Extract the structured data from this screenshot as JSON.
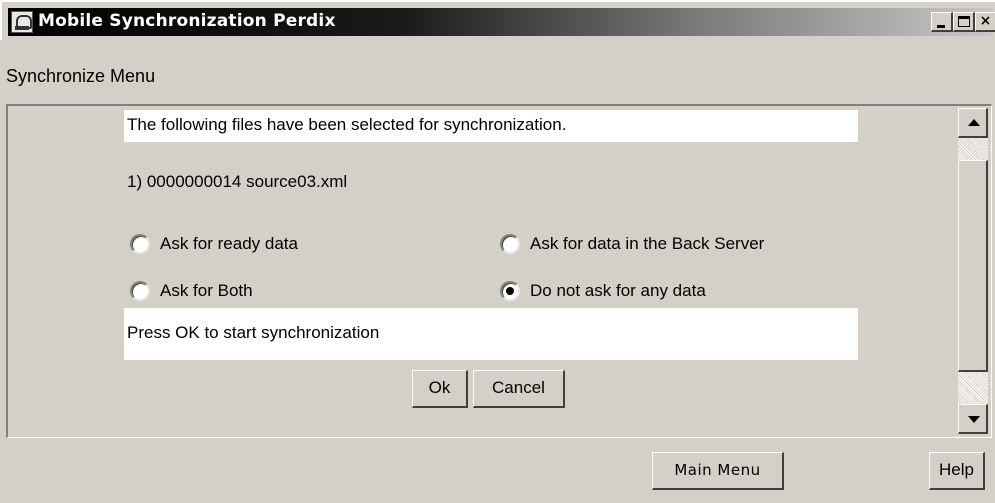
{
  "window": {
    "title": "Mobile Synchronization Perdix",
    "icon": "perdix-app-icon",
    "controls": {
      "minimize": "minimize-icon",
      "maximize": "maximize-icon",
      "close": "×"
    }
  },
  "menu_label": "Synchronize Menu",
  "sync": {
    "header": "The following files have been selected for synchronization.",
    "files": [
      {
        "line": "1) 0000000014   source03.xml"
      }
    ],
    "options": [
      {
        "label": "Ask for ready data",
        "checked": false
      },
      {
        "label": "Ask for data in the Back Server",
        "checked": false
      },
      {
        "label": "Ask for Both",
        "checked": false
      },
      {
        "label": "Do not ask for any data",
        "checked": true
      }
    ],
    "prompt": "Press OK to start synchronization",
    "ok_label": "Ok",
    "cancel_label": "Cancel"
  },
  "scrollbar": {
    "up_icon": "arrow-up-icon",
    "down_icon": "arrow-down-icon"
  },
  "footer": {
    "main_menu_label": "Main Menu",
    "help_label": "Help"
  }
}
